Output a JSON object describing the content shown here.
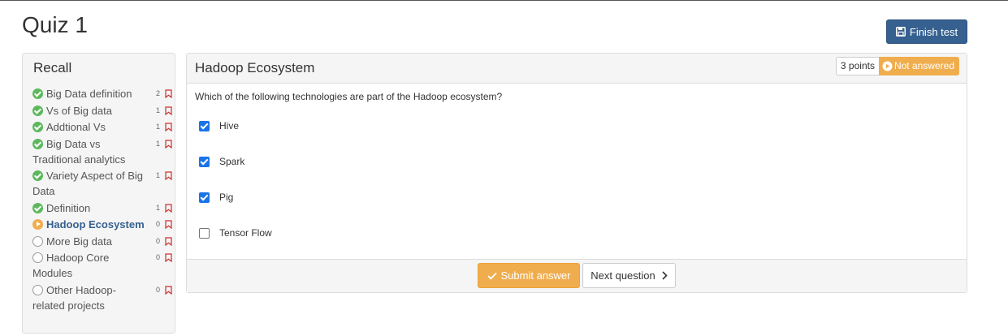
{
  "page": {
    "title": "Quiz 1"
  },
  "toolbar": {
    "finish_label": "Finish test",
    "finish_icon": "save-icon"
  },
  "sidebar": {
    "title": "Recall",
    "items": [
      {
        "label": "Big Data definition",
        "count": "2",
        "status": "done"
      },
      {
        "label": "Vs of Big data",
        "count": "1",
        "status": "done"
      },
      {
        "label": "Addtional Vs",
        "count": "1",
        "status": "done"
      },
      {
        "label": "Big Data vs Traditional analytics",
        "count": "1",
        "status": "done"
      },
      {
        "label": "Variety Aspect of Big Data",
        "count": "1",
        "status": "done"
      },
      {
        "label": "Definition",
        "count": "1",
        "status": "done"
      },
      {
        "label": "Hadoop Ecosystem",
        "count": "0",
        "status": "current"
      },
      {
        "label": "More Big data",
        "count": "0",
        "status": "todo"
      },
      {
        "label": "Hadoop Core Modules",
        "count": "0",
        "status": "todo"
      },
      {
        "label": "Other Hadoop-related projects",
        "count": "0",
        "status": "todo"
      }
    ]
  },
  "question": {
    "title": "Hadoop Ecosystem",
    "points": "3 points",
    "status": "Not answered",
    "status_color": "#f0ad4e",
    "text": "Which of the following technologies are part of the Hadoop ecosystem?",
    "options": [
      {
        "label": "Hive",
        "checked": true
      },
      {
        "label": "Spark",
        "checked": true
      },
      {
        "label": "Pig",
        "checked": true
      },
      {
        "label": "Tensor Flow",
        "checked": false
      }
    ]
  },
  "footer": {
    "submit_label": "Submit answer",
    "next_label": "Next question"
  },
  "colors": {
    "primary": "#35608f",
    "warning": "#f0ad4e",
    "success": "#5cb85c",
    "checkbox": "#1a73e8"
  }
}
